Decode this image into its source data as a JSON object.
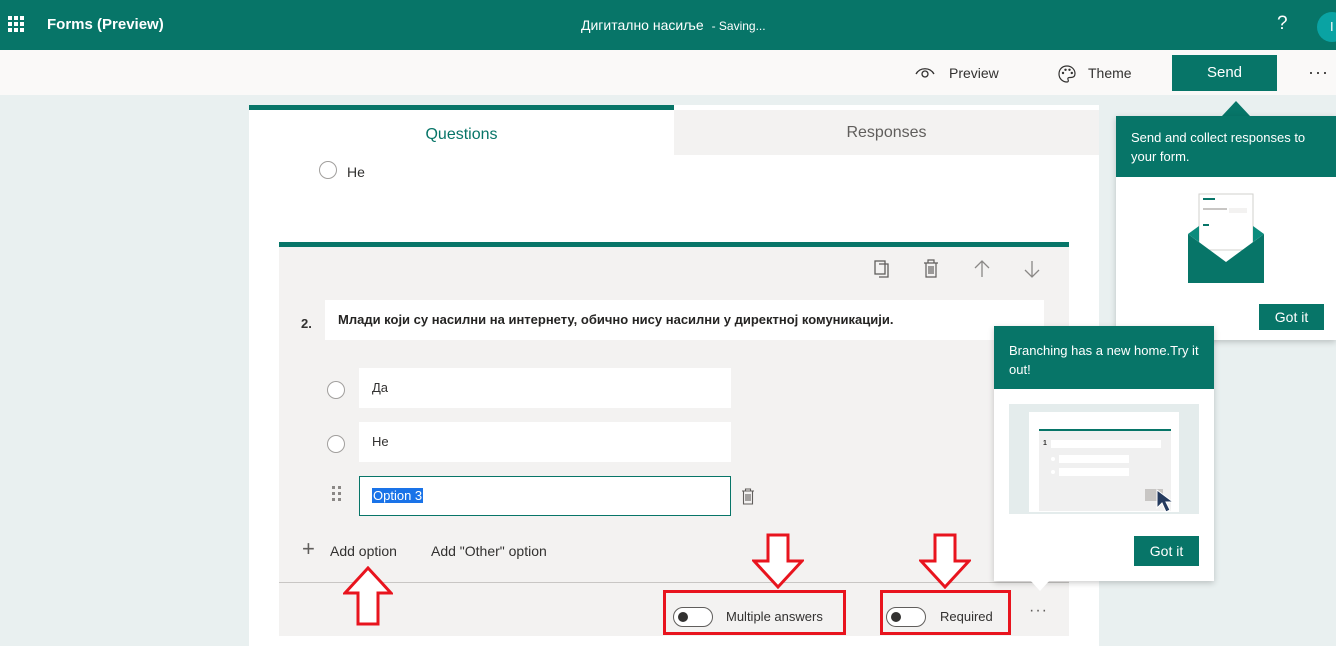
{
  "topbar": {
    "app_title": "Forms (Preview)",
    "doc_title": "Дигитално насиље",
    "doc_status": "- Saving...",
    "help": "?",
    "avatar_initial": "I"
  },
  "commandbar": {
    "preview": "Preview",
    "theme": "Theme",
    "send": "Send",
    "more": "···"
  },
  "tabs": {
    "questions": "Questions",
    "responses": "Responses"
  },
  "previous_question": {
    "option": "Не"
  },
  "question": {
    "number": "2.",
    "text": "Млади који су насилни на интернету, обично нису насилни у директној комуникацији.",
    "options": [
      "Да",
      "Не",
      "Option 3"
    ],
    "add_option": "Add option",
    "add_other": "Add \"Other\" option",
    "multiple_answers_label": "Multiple answers",
    "multiple_answers_on": false,
    "required_label": "Required",
    "required_on": false,
    "more": "···"
  },
  "popups": {
    "send": {
      "text": "Send and collect responses to your form.",
      "button": "Got it"
    },
    "branching": {
      "text": "Branching has a new home.Try it out!",
      "button": "Got it",
      "illustration_number": "1"
    }
  },
  "colors": {
    "brand": "#077568",
    "annotation": "#e8141e",
    "selection": "#1a73e8"
  },
  "icons": [
    "app-launcher-icon",
    "eye-icon",
    "palette-icon",
    "copy-icon",
    "trash-icon",
    "arrow-up-icon",
    "arrow-down-icon",
    "drag-handle-icon",
    "plus-icon",
    "envelope-icon",
    "cursor-icon"
  ]
}
